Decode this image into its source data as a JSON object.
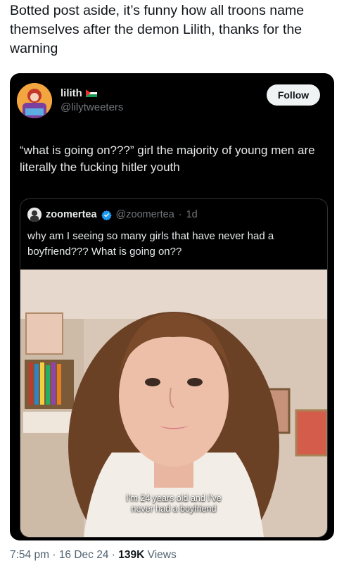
{
  "post": {
    "text": "Botted post aside, it’s funny how all troons name themselves after the demon Lilith, thanks for the warning"
  },
  "quoted_tweet": {
    "author_name": "lilith",
    "handle": "@lilytweeters",
    "follow_label": "Follow",
    "body": "“what is going on???” girl the majority of young men are literally the fucking hitler youth",
    "flag_colors": [
      "#000000",
      "#ffffff",
      "#149954",
      "#e4312b"
    ],
    "inner_quote": {
      "author_name": "zoomertea",
      "handle": "@zoomertea",
      "age": "1d",
      "separator": "·",
      "text": "why am I seeing so many girls that have never had a boyfriend??? What is going on??",
      "media_caption_line1": "I’m 24 years old and I’ve",
      "media_caption_line2": "never had a boyfriend"
    }
  },
  "meta": {
    "time": "7:54 pm",
    "date": "16 Dec 24",
    "views_count": "139K",
    "views_label": "Views",
    "separator": "·"
  }
}
